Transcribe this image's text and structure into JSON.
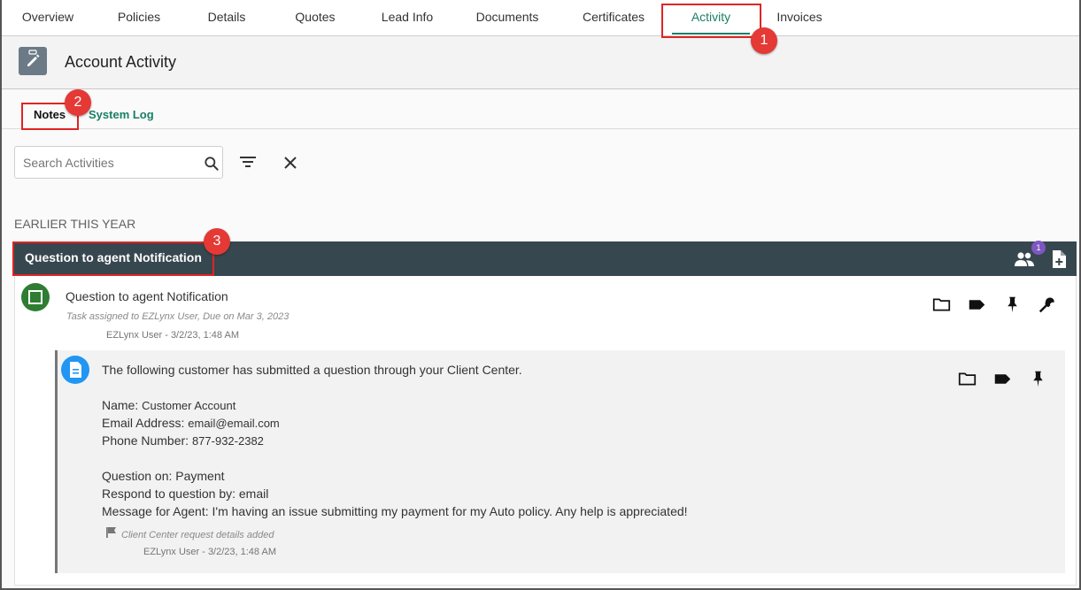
{
  "top_tabs": [
    {
      "label": "Overview"
    },
    {
      "label": "Policies"
    },
    {
      "label": "Details"
    },
    {
      "label": "Quotes"
    },
    {
      "label": "Lead Info"
    },
    {
      "label": "Documents"
    },
    {
      "label": "Certificates"
    },
    {
      "label": "Activity",
      "active": true
    },
    {
      "label": "Invoices"
    }
  ],
  "header": {
    "title": "Account Activity",
    "icon": "edit-clipboard-icon"
  },
  "sub_tabs": [
    {
      "label": "Notes",
      "active": true
    },
    {
      "label": "System Log"
    }
  ],
  "search": {
    "placeholder": "Search Activities",
    "value": ""
  },
  "section_label": "EARLIER THIS YEAR",
  "group": {
    "title": "Question to agent Notification",
    "people_badge_count": "1"
  },
  "task": {
    "title": "Question to agent Notification",
    "meta": "Task assigned to EZLynx User, Due on Mar 3, 2023",
    "author": "EZLynx User - 3/2/23, 1:48 AM"
  },
  "note": {
    "intro": "The following customer has submitted a question through your Client Center.",
    "name_label": "Name:",
    "name_value": "Customer Account",
    "email_label": "Email Address:",
    "email_value": "email@email.com",
    "phone_label": "Phone Number:",
    "phone_value": "877-932-2382",
    "question_on": "Question on: Payment",
    "respond_by": "Respond to question by: email",
    "message": "Message for Agent: I'm having an issue submitting my payment for my Auto policy. Any help is appreciated!",
    "flag_text": "Client Center request details added",
    "author": "EZLynx User - 3/2/23, 1:48 AM"
  },
  "callouts": [
    "1",
    "2",
    "3"
  ],
  "colors": {
    "accent": "#1a7f64",
    "group_header": "#37474f",
    "callout": "#e53935"
  }
}
